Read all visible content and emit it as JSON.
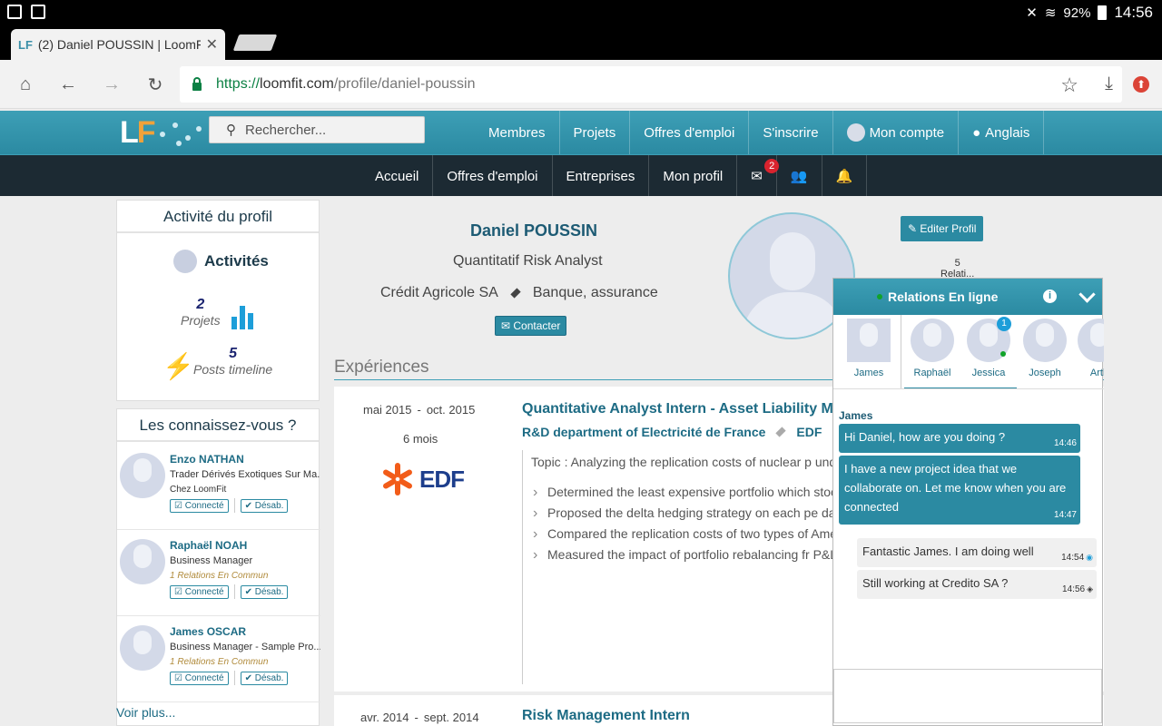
{
  "statusbar": {
    "battery": "92%",
    "time": "14:56"
  },
  "browser": {
    "tab_title": "(2) Daniel POUSSIN | LoomFit",
    "tab_favicon": "LF",
    "url_scheme": "https://",
    "url_host": "loomfit.com",
    "url_path": "/profile/daniel-poussin"
  },
  "site": {
    "logo": "LF",
    "search_placeholder": "Rechercher...",
    "topmenu": [
      "Membres",
      "Projets",
      "Offres d'emploi",
      "S'inscrire",
      "Mon compte",
      "Anglais"
    ],
    "submenu": [
      "Accueil",
      "Offres d'emploi",
      "Entreprises",
      "Mon profil"
    ],
    "messages_badge": "2"
  },
  "activity": {
    "title": "Activité du profil",
    "heading": "Activités",
    "projets_count": "2",
    "projets_label": "Projets",
    "posts_count": "5",
    "posts_label": "Posts timeline"
  },
  "know": {
    "title": "Les connaissez-vous ?",
    "people": [
      {
        "name": "Enzo NATHAN",
        "role": "Trader Dérivés Exotiques Sur Ma...",
        "extra": "Chez LoomFit",
        "connect": "Connecté",
        "disable": "Désab."
      },
      {
        "name": "Raphaël NOAH",
        "role": "Business Manager",
        "extra": "1 Relations En Commun",
        "connect": "Connecté",
        "disable": "Désab."
      },
      {
        "name": "James OSCAR",
        "role": "Business Manager - Sample Pro...",
        "extra": "1 Relations En Commun",
        "connect": "Connecté",
        "disable": "Désab."
      }
    ],
    "more": "Voir plus..."
  },
  "profile": {
    "name": "Daniel POUSSIN",
    "title": "Quantitatif Risk Analyst",
    "company": "Crédit Agricole SA",
    "sector": "Banque, assurance",
    "contact_button": "Contacter",
    "edit_button": "Editer Profil",
    "relations_count": "5",
    "relations_label": "Relati..."
  },
  "experiences": {
    "heading": "Expériences",
    "items": [
      {
        "start": "mai 2015",
        "end": "oct. 2015",
        "duration": "6 mois",
        "logo_text": "EDF",
        "title": "Quantitative Analyst Intern - Asset Liability Ma",
        "department": "R&D department of Electricité de France",
        "company": "EDF",
        "topic": "Topic : Analyzing the replication costs of nuclear p under multiple shortfall risk constraints",
        "bullets": [
          "Determined the least expensive portfolio which stochastic benchmarks at any constraint date",
          "Proposed the delta hedging strategy on each pe dates",
          "Compared the replication costs of two types of American) through the Value-at-Risk and others",
          "Measured the impact of portfolio rebalancing fr P&L"
        ]
      },
      {
        "start": "avr. 2014",
        "end": "sept. 2014",
        "title": "Risk Management Intern"
      }
    ]
  },
  "chat": {
    "title": "Relations En ligne",
    "contacts": [
      {
        "name": "James",
        "badge": ""
      },
      {
        "name": "Raphaël",
        "badge": ""
      },
      {
        "name": "Jessica",
        "badge": "1"
      },
      {
        "name": "Joseph",
        "badge": ""
      },
      {
        "name": "Arth",
        "badge": ""
      }
    ],
    "sender": "James",
    "messages": [
      {
        "text": "Hi Daniel, how are you doing ?",
        "time": "14:46"
      },
      {
        "text": "I have a new project idea that we collaborate on. Let me know when you are connected",
        "time": "14:47"
      },
      {
        "text": "Fantastic James. I am doing well",
        "time": "14:54"
      },
      {
        "text": "Still working at Credito SA ?",
        "time": "14:56"
      }
    ]
  }
}
